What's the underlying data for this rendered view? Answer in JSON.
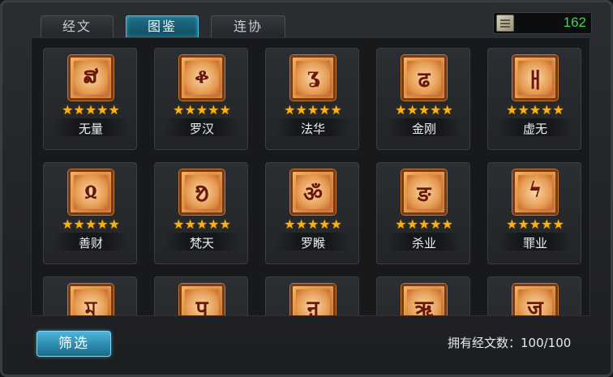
{
  "tabs": [
    {
      "label": "经文",
      "active": false
    },
    {
      "label": "图鉴",
      "active": true
    },
    {
      "label": "连协",
      "active": false
    }
  ],
  "currency": {
    "icon": "scroll-icon",
    "value": "162",
    "color": "#42d35a"
  },
  "cards": [
    {
      "name": "无量",
      "glyph": "ສ",
      "stars": "★★★★★",
      "rating": 5
    },
    {
      "name": "罗汉",
      "glyph": "ቆ",
      "stars": "★★★★★",
      "rating": 5
    },
    {
      "name": "法华",
      "glyph": "ʓ",
      "stars": "★★★★★",
      "rating": 5
    },
    {
      "name": "金刚",
      "glyph": "ढ",
      "stars": "★★★★★",
      "rating": 5
    },
    {
      "name": "虚无",
      "glyph": "ㅐ",
      "stars": "★★★★★",
      "rating": 5
    },
    {
      "name": "善财",
      "glyph": "ჲ",
      "stars": "★★★★★",
      "rating": 5
    },
    {
      "name": "梵天",
      "glyph": "ᱚ",
      "stars": "★★★★★",
      "rating": 5
    },
    {
      "name": "罗睺",
      "glyph": "ॐ",
      "stars": "★★★★★",
      "rating": 5
    },
    {
      "name": "杀业",
      "glyph": "ङ",
      "stars": "★★★★★",
      "rating": 5
    },
    {
      "name": "罪业",
      "glyph": "ϟ",
      "stars": "★★★★★",
      "rating": 5
    },
    {
      "name": "",
      "glyph": "ম",
      "stars": "",
      "rating": 0
    },
    {
      "name": "",
      "glyph": "प",
      "stars": "",
      "rating": 0
    },
    {
      "name": "",
      "glyph": "ऩ",
      "stars": "",
      "rating": 0
    },
    {
      "name": "",
      "glyph": "ऋ",
      "stars": "",
      "rating": 0
    },
    {
      "name": "",
      "glyph": "ज",
      "stars": "",
      "rating": 0
    }
  ],
  "footer": {
    "filter_label": "筛选",
    "owned_text": "拥有经文数：100/100"
  },
  "colors": {
    "accent": "#1f6f86",
    "star": "#f6b21a",
    "tile": "#e59a52"
  }
}
